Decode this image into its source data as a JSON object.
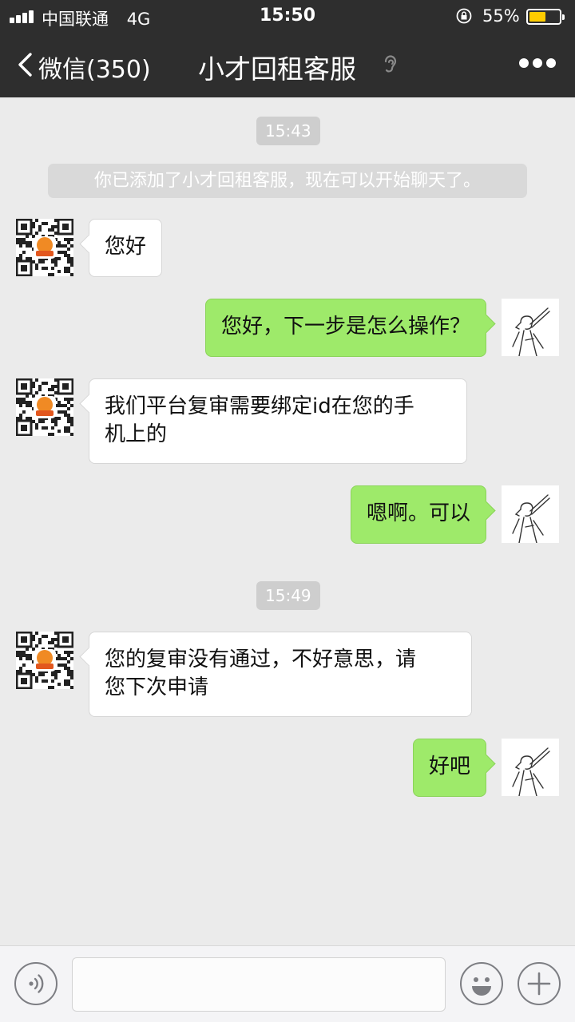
{
  "status_bar": {
    "carrier": "中国联通",
    "network": "4G",
    "time": "15:50",
    "battery_percent": "55%",
    "battery_level": 0.55,
    "battery_color": "#ffcc00"
  },
  "nav": {
    "back_label": "微信(350)",
    "title": "小才回租客服",
    "icons": [
      "chevron-left-icon",
      "ear-icon",
      "more-icon"
    ]
  },
  "chat": {
    "timestamps": [
      "15:43",
      "15:49"
    ],
    "system_notice": "你已添加了小才回租客服，现在可以开始聊天了。",
    "messages": [
      {
        "sender": "客服",
        "direction": "in",
        "lines": [
          "您好"
        ]
      },
      {
        "sender": "me",
        "direction": "out",
        "lines": [
          "您好，下一步是怎么操作？"
        ]
      },
      {
        "sender": "客服",
        "direction": "in",
        "lines": [
          "我们平台复审需要绑定id在您的手",
          "机上的"
        ]
      },
      {
        "sender": "me",
        "direction": "out",
        "lines": [
          "嗯啊。可以"
        ]
      },
      {
        "sender": "客服",
        "direction": "in",
        "lines": [
          "您的复审没有通过，不好意思，请",
          "您下次申请"
        ]
      },
      {
        "sender": "me",
        "direction": "out",
        "lines": [
          "好吧"
        ]
      }
    ]
  },
  "input_bar": {
    "text_value": "",
    "icons": [
      "voice-icon",
      "emoji-icon",
      "plus-icon"
    ]
  },
  "colors": {
    "nav_background": "#2e2e2e",
    "chat_background": "#ebebeb",
    "outgoing_bubble": "#9eea6a",
    "incoming_bubble": "#ffffff"
  }
}
